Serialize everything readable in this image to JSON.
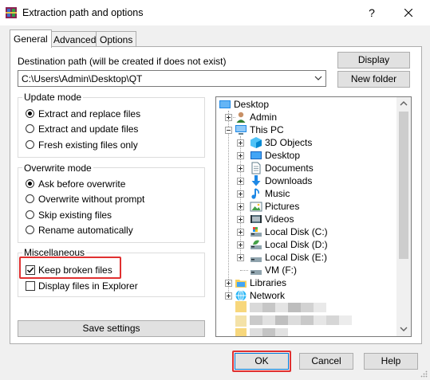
{
  "window": {
    "title": "Extraction path and options",
    "help": "?"
  },
  "tabs": [
    {
      "label": "General"
    },
    {
      "label": "Advanced"
    },
    {
      "label": "Options"
    }
  ],
  "destination": {
    "label": "Destination path (will be created if does not exist)",
    "value": "C:\\Users\\Admin\\Desktop\\QT",
    "display_button": "Display",
    "new_folder_button": "New folder"
  },
  "update_mode": {
    "title": "Update mode",
    "options": [
      {
        "label": "Extract and replace files",
        "selected": true
      },
      {
        "label": "Extract and update files",
        "selected": false
      },
      {
        "label": "Fresh existing files only",
        "selected": false
      }
    ]
  },
  "overwrite_mode": {
    "title": "Overwrite mode",
    "options": [
      {
        "label": "Ask before overwrite",
        "selected": true
      },
      {
        "label": "Overwrite without prompt",
        "selected": false
      },
      {
        "label": "Skip existing files",
        "selected": false
      },
      {
        "label": "Rename automatically",
        "selected": false
      }
    ]
  },
  "miscellaneous": {
    "title": "Miscellaneous",
    "options": [
      {
        "label": "Keep broken files",
        "checked": true
      },
      {
        "label": "Display files in Explorer",
        "checked": false
      }
    ]
  },
  "save_settings_button": "Save settings",
  "tree": {
    "items": [
      {
        "label": "Desktop",
        "icon": "desktop-icon"
      },
      {
        "label": "Admin",
        "icon": "user-icon"
      },
      {
        "label": "This PC",
        "icon": "computer-icon"
      },
      {
        "label": "3D Objects",
        "icon": "cube-icon"
      },
      {
        "label": "Desktop",
        "icon": "desktop-icon"
      },
      {
        "label": "Documents",
        "icon": "document-icon"
      },
      {
        "label": "Downloads",
        "icon": "download-icon"
      },
      {
        "label": "Music",
        "icon": "music-icon"
      },
      {
        "label": "Pictures",
        "icon": "pictures-icon"
      },
      {
        "label": "Videos",
        "icon": "video-icon"
      },
      {
        "label": "Local Disk (C:)",
        "icon": "drive-icon"
      },
      {
        "label": "Local Disk (D:)",
        "icon": "drive-icon"
      },
      {
        "label": "Local Disk (E:)",
        "icon": "drive-icon"
      },
      {
        "label": "VM (F:)",
        "icon": "drive-icon"
      },
      {
        "label": "Libraries",
        "icon": "libraries-icon"
      },
      {
        "label": "Network",
        "icon": "network-icon"
      }
    ]
  },
  "buttons": {
    "ok": "OK",
    "cancel": "Cancel",
    "help": "Help"
  },
  "colors": {
    "highlight": "#e03030",
    "accent": "#0078d7",
    "folder": "#f7cf5c"
  }
}
